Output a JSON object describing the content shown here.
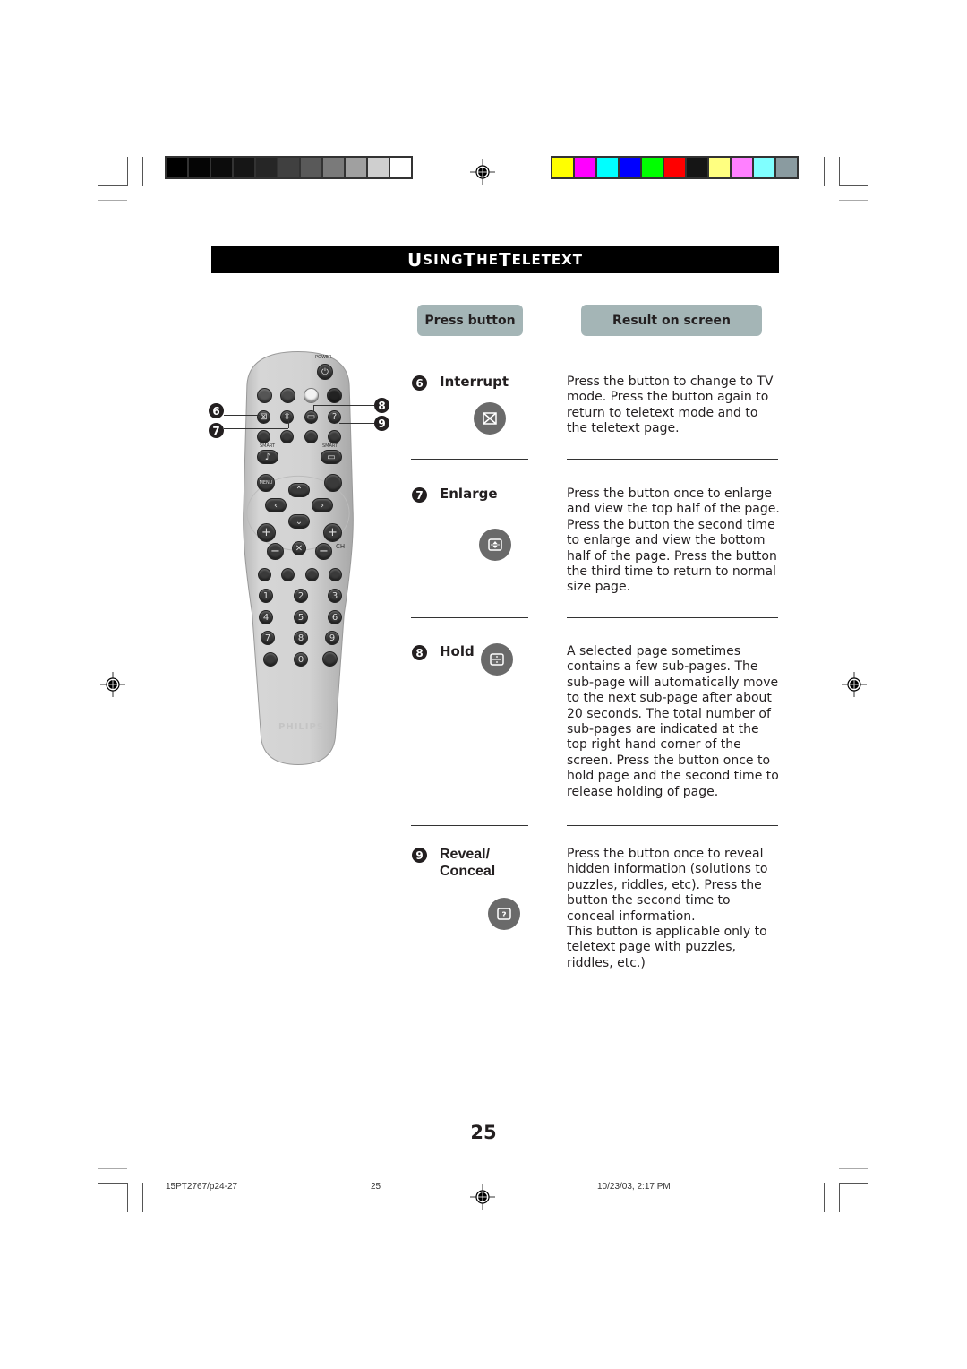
{
  "page": {
    "section_title_first": [
      "U",
      "SING ",
      "T",
      "HE ",
      "T",
      "ELETEXT"
    ],
    "section_title": "Using The Teletext",
    "page_number": "25"
  },
  "columns": {
    "press_button": "Press button",
    "result_on_screen": "Result on screen"
  },
  "items": [
    {
      "number": "6",
      "label": "Interrupt",
      "icon": "interrupt-icon",
      "description": "Press the button to change to TV mode. Press the button again to return to teletext mode and to the teletext page."
    },
    {
      "number": "7",
      "label": "Enlarge",
      "icon": "enlarge-icon",
      "description": "Press the button once to enlarge and view the top half of the page. Press the button the second time to enlarge and view the bottom half of the page. Press the button the third time to return to normal size page."
    },
    {
      "number": "8",
      "label": "Hold",
      "icon": "hold-icon",
      "description": "A selected page sometimes contains a few sub-pages. The sub-page will automatically move to the next sub-page after about 20 seconds. The total number of sub-pages are indicated at the top right hand corner of the screen. Press the button once to hold page and the second time to release holding of page."
    },
    {
      "number": "9",
      "label_line1": "Reveal/",
      "label_line2": "Conceal",
      "icon": "reveal-icon",
      "description": "Press the button once to reveal hidden information (solutions to puzzles, riddles, etc). Press the button the second time to conceal information.",
      "description2": "This button is applicable only to teletext page with puzzles, riddles, etc.)"
    }
  ],
  "remote": {
    "power_label": "POWER",
    "smart_left": "SMART",
    "smart_right": "SMART",
    "menu_label": "MENU",
    "brand": "PHILIPS",
    "ch_label": "CH",
    "digits": [
      "1",
      "2",
      "3",
      "4",
      "5",
      "6",
      "7",
      "8",
      "9",
      "0"
    ],
    "callouts": [
      "6",
      "7",
      "8",
      "9"
    ]
  },
  "print_marks": {
    "grayscale_bar": [
      "#000000",
      "#050505",
      "#0c0c0c",
      "#161616",
      "#262626",
      "#404040",
      "#595959",
      "#7a7a7a",
      "#a0a0a0",
      "#cfcfcf",
      "#ffffff"
    ],
    "color_bar": [
      "#ffff00",
      "#ff00ff",
      "#00ffff",
      "#0000ff",
      "#00ff00",
      "#ff0000",
      "#151515",
      "#ffff80",
      "#ff80ff",
      "#80ffff",
      "#8a9ba0"
    ]
  },
  "footer": {
    "file": "15PT2767/p24-27",
    "page": "25",
    "timestamp": "10/23/03, 2:17 PM"
  }
}
